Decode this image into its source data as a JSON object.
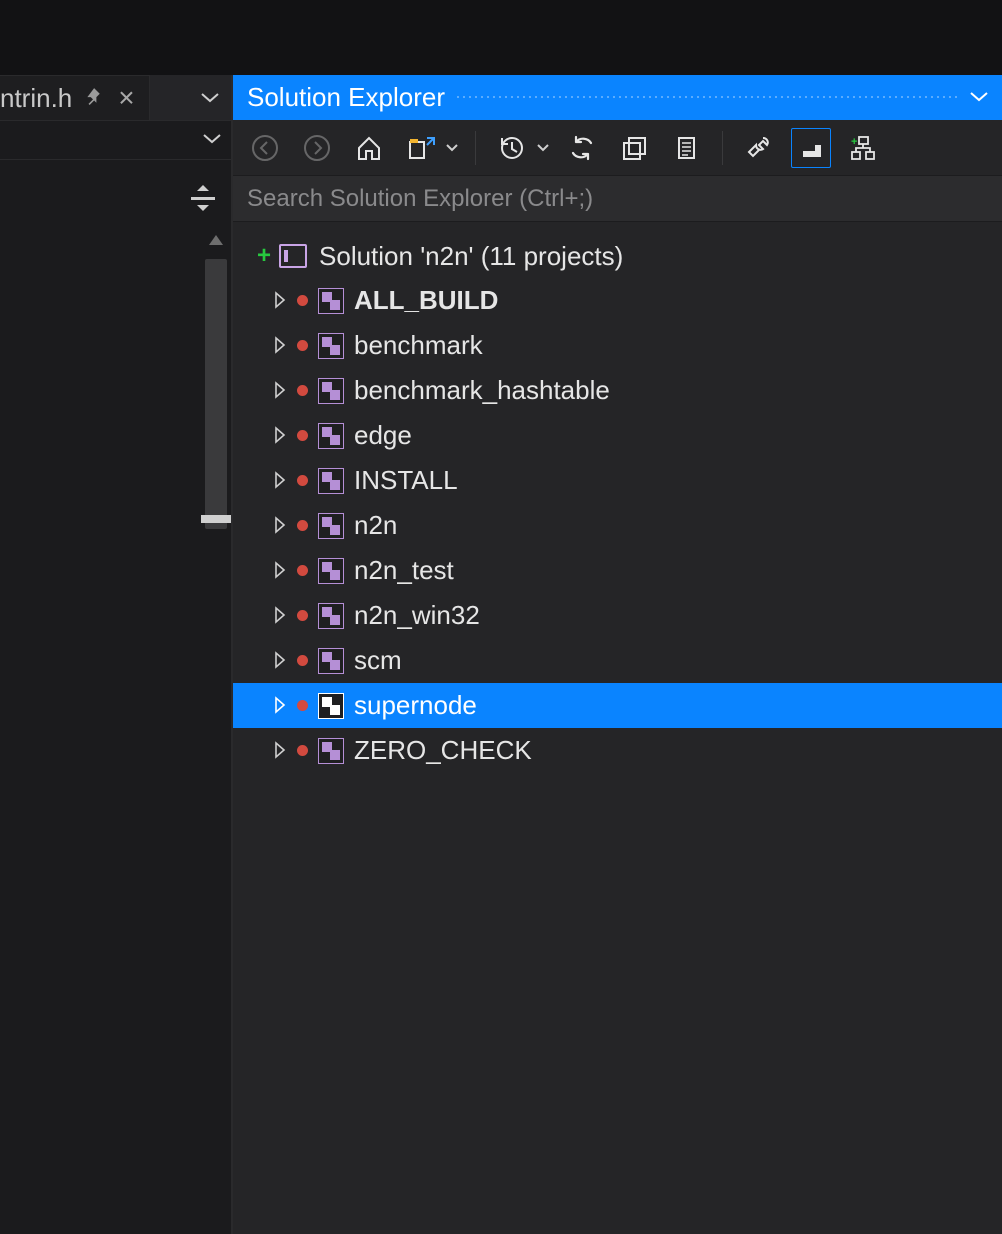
{
  "editor": {
    "tab_name": "ntrin.h"
  },
  "sx": {
    "title": "Solution Explorer",
    "search_placeholder": "Search Solution Explorer (Ctrl+;)",
    "solution_label": "Solution 'n2n' (11 projects)",
    "projects": [
      {
        "name": "ALL_BUILD",
        "bold": true,
        "selected": false
      },
      {
        "name": "benchmark",
        "bold": false,
        "selected": false
      },
      {
        "name": "benchmark_hashtable",
        "bold": false,
        "selected": false
      },
      {
        "name": "edge",
        "bold": false,
        "selected": false
      },
      {
        "name": "INSTALL",
        "bold": false,
        "selected": false
      },
      {
        "name": "n2n",
        "bold": false,
        "selected": false
      },
      {
        "name": "n2n_test",
        "bold": false,
        "selected": false
      },
      {
        "name": "n2n_win32",
        "bold": false,
        "selected": false
      },
      {
        "name": "scm",
        "bold": false,
        "selected": false
      },
      {
        "name": "supernode",
        "bold": false,
        "selected": true
      },
      {
        "name": "ZERO_CHECK",
        "bold": false,
        "selected": false
      }
    ]
  }
}
